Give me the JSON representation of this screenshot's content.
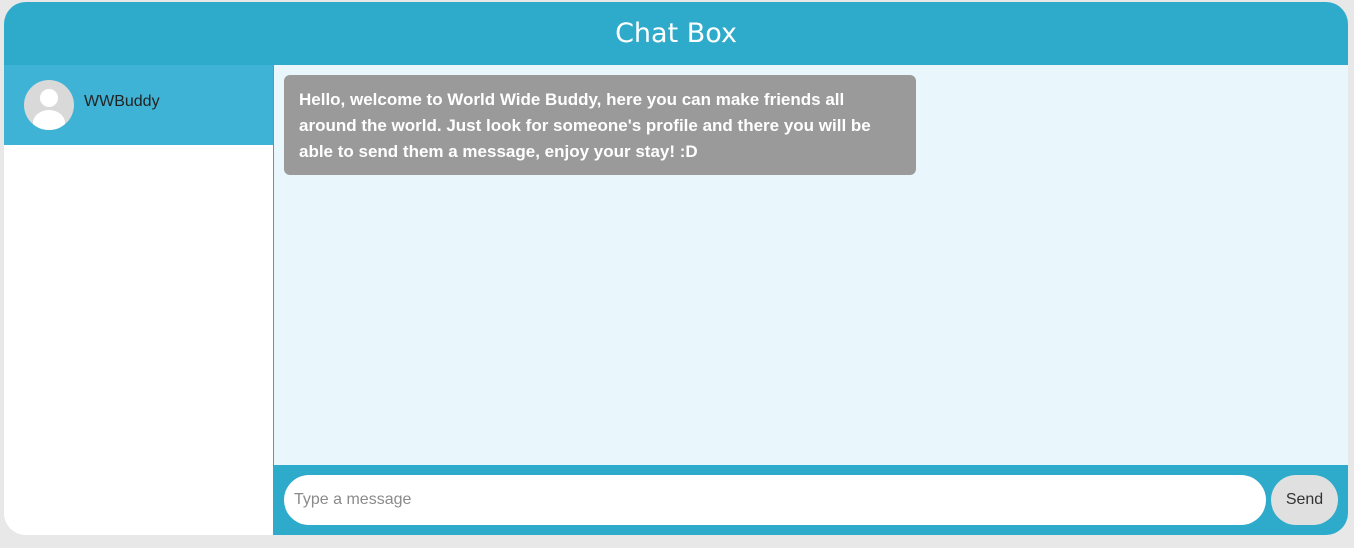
{
  "header": {
    "title": "Chat Box"
  },
  "sidebar": {
    "contacts": [
      {
        "name": "WWBuddy",
        "avatar_icon": "user-avatar-icon"
      }
    ]
  },
  "chat": {
    "messages": [
      {
        "text": "Hello, welcome to World Wide Buddy, here you can make friends all around the world. Just look for someone's profile and there you will be able to send them a message, enjoy your stay! :D"
      }
    ]
  },
  "composer": {
    "placeholder": "Type a message",
    "value": "",
    "send_label": "Send"
  },
  "colors": {
    "header": "#2eaacb",
    "contact_selected": "#3fb3d5",
    "chat_background": "#e9f7fd",
    "message_bubble": "#9a9a9a",
    "send_button": "#e0e0e0"
  }
}
